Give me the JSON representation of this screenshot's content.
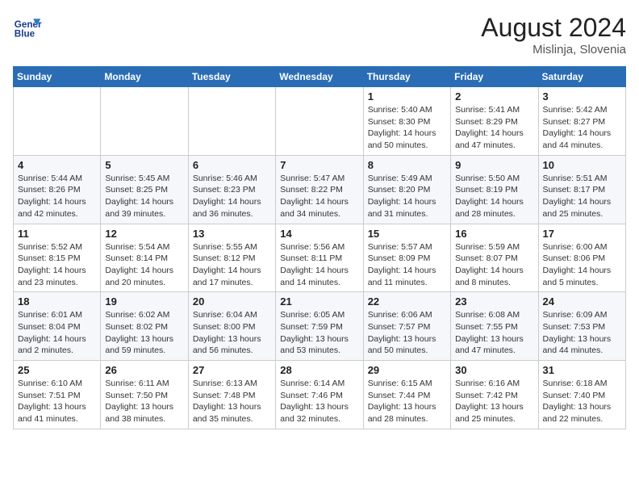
{
  "header": {
    "logo_line1": "General",
    "logo_line2": "Blue",
    "main_title": "August 2024",
    "subtitle": "Mislinja, Slovenia"
  },
  "calendar": {
    "days_of_week": [
      "Sunday",
      "Monday",
      "Tuesday",
      "Wednesday",
      "Thursday",
      "Friday",
      "Saturday"
    ],
    "weeks": [
      [
        {
          "day": "",
          "info": ""
        },
        {
          "day": "",
          "info": ""
        },
        {
          "day": "",
          "info": ""
        },
        {
          "day": "",
          "info": ""
        },
        {
          "day": "1",
          "info": "Sunrise: 5:40 AM\nSunset: 8:30 PM\nDaylight: 14 hours and 50 minutes."
        },
        {
          "day": "2",
          "info": "Sunrise: 5:41 AM\nSunset: 8:29 PM\nDaylight: 14 hours and 47 minutes."
        },
        {
          "day": "3",
          "info": "Sunrise: 5:42 AM\nSunset: 8:27 PM\nDaylight: 14 hours and 44 minutes."
        }
      ],
      [
        {
          "day": "4",
          "info": "Sunrise: 5:44 AM\nSunset: 8:26 PM\nDaylight: 14 hours and 42 minutes."
        },
        {
          "day": "5",
          "info": "Sunrise: 5:45 AM\nSunset: 8:25 PM\nDaylight: 14 hours and 39 minutes."
        },
        {
          "day": "6",
          "info": "Sunrise: 5:46 AM\nSunset: 8:23 PM\nDaylight: 14 hours and 36 minutes."
        },
        {
          "day": "7",
          "info": "Sunrise: 5:47 AM\nSunset: 8:22 PM\nDaylight: 14 hours and 34 minutes."
        },
        {
          "day": "8",
          "info": "Sunrise: 5:49 AM\nSunset: 8:20 PM\nDaylight: 14 hours and 31 minutes."
        },
        {
          "day": "9",
          "info": "Sunrise: 5:50 AM\nSunset: 8:19 PM\nDaylight: 14 hours and 28 minutes."
        },
        {
          "day": "10",
          "info": "Sunrise: 5:51 AM\nSunset: 8:17 PM\nDaylight: 14 hours and 25 minutes."
        }
      ],
      [
        {
          "day": "11",
          "info": "Sunrise: 5:52 AM\nSunset: 8:15 PM\nDaylight: 14 hours and 23 minutes."
        },
        {
          "day": "12",
          "info": "Sunrise: 5:54 AM\nSunset: 8:14 PM\nDaylight: 14 hours and 20 minutes."
        },
        {
          "day": "13",
          "info": "Sunrise: 5:55 AM\nSunset: 8:12 PM\nDaylight: 14 hours and 17 minutes."
        },
        {
          "day": "14",
          "info": "Sunrise: 5:56 AM\nSunset: 8:11 PM\nDaylight: 14 hours and 14 minutes."
        },
        {
          "day": "15",
          "info": "Sunrise: 5:57 AM\nSunset: 8:09 PM\nDaylight: 14 hours and 11 minutes."
        },
        {
          "day": "16",
          "info": "Sunrise: 5:59 AM\nSunset: 8:07 PM\nDaylight: 14 hours and 8 minutes."
        },
        {
          "day": "17",
          "info": "Sunrise: 6:00 AM\nSunset: 8:06 PM\nDaylight: 14 hours and 5 minutes."
        }
      ],
      [
        {
          "day": "18",
          "info": "Sunrise: 6:01 AM\nSunset: 8:04 PM\nDaylight: 14 hours and 2 minutes."
        },
        {
          "day": "19",
          "info": "Sunrise: 6:02 AM\nSunset: 8:02 PM\nDaylight: 13 hours and 59 minutes."
        },
        {
          "day": "20",
          "info": "Sunrise: 6:04 AM\nSunset: 8:00 PM\nDaylight: 13 hours and 56 minutes."
        },
        {
          "day": "21",
          "info": "Sunrise: 6:05 AM\nSunset: 7:59 PM\nDaylight: 13 hours and 53 minutes."
        },
        {
          "day": "22",
          "info": "Sunrise: 6:06 AM\nSunset: 7:57 PM\nDaylight: 13 hours and 50 minutes."
        },
        {
          "day": "23",
          "info": "Sunrise: 6:08 AM\nSunset: 7:55 PM\nDaylight: 13 hours and 47 minutes."
        },
        {
          "day": "24",
          "info": "Sunrise: 6:09 AM\nSunset: 7:53 PM\nDaylight: 13 hours and 44 minutes."
        }
      ],
      [
        {
          "day": "25",
          "info": "Sunrise: 6:10 AM\nSunset: 7:51 PM\nDaylight: 13 hours and 41 minutes."
        },
        {
          "day": "26",
          "info": "Sunrise: 6:11 AM\nSunset: 7:50 PM\nDaylight: 13 hours and 38 minutes."
        },
        {
          "day": "27",
          "info": "Sunrise: 6:13 AM\nSunset: 7:48 PM\nDaylight: 13 hours and 35 minutes."
        },
        {
          "day": "28",
          "info": "Sunrise: 6:14 AM\nSunset: 7:46 PM\nDaylight: 13 hours and 32 minutes."
        },
        {
          "day": "29",
          "info": "Sunrise: 6:15 AM\nSunset: 7:44 PM\nDaylight: 13 hours and 28 minutes."
        },
        {
          "day": "30",
          "info": "Sunrise: 6:16 AM\nSunset: 7:42 PM\nDaylight: 13 hours and 25 minutes."
        },
        {
          "day": "31",
          "info": "Sunrise: 6:18 AM\nSunset: 7:40 PM\nDaylight: 13 hours and 22 minutes."
        }
      ]
    ]
  }
}
